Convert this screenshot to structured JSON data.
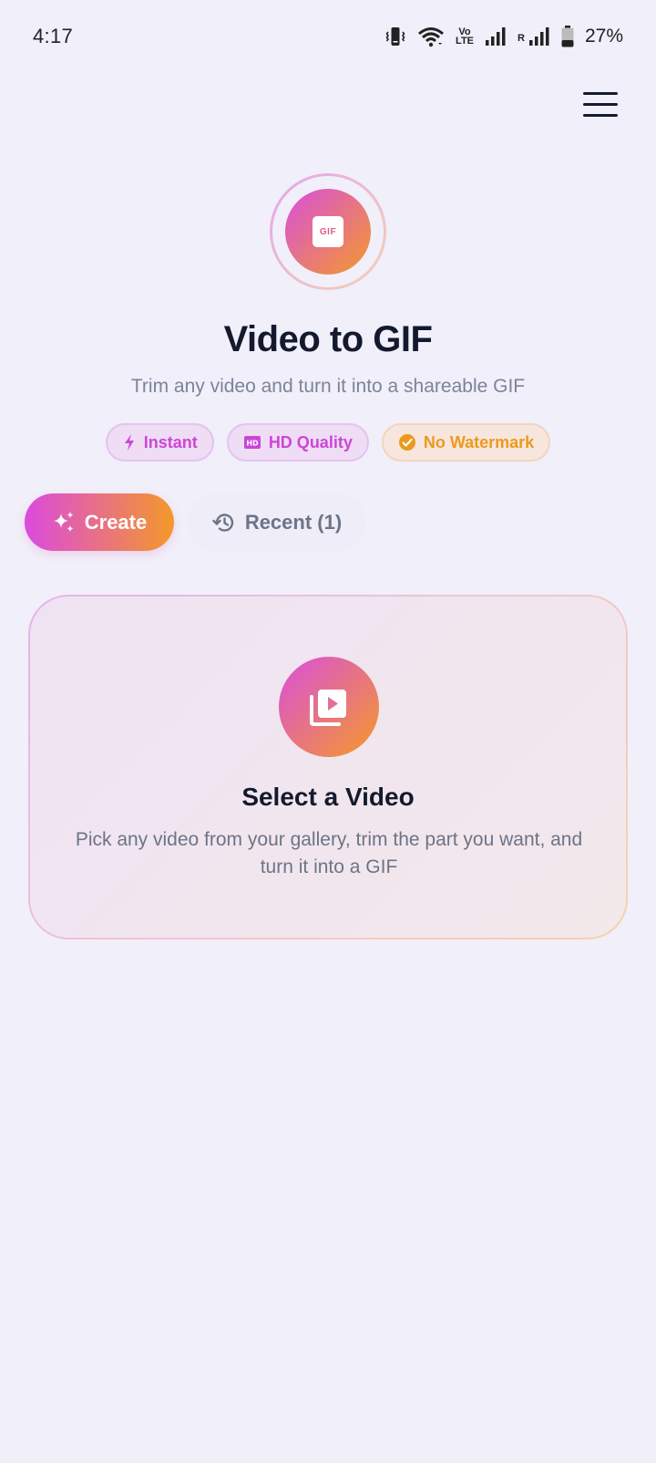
{
  "status_bar": {
    "time": "4:17",
    "volte_line1": "Vo",
    "volte_line2": "LTE",
    "roaming": "R",
    "battery": "27%"
  },
  "header": {
    "logo_badge": "GIF",
    "title": "Video to GIF",
    "subtitle": "Trim any video and turn it into a shareable GIF"
  },
  "features": [
    {
      "label": "Instant",
      "icon": "bolt-icon",
      "color": "#cc46d6"
    },
    {
      "label": "HD Quality",
      "icon": "hd-icon",
      "color": "#cc46d6"
    },
    {
      "label": "No Watermark",
      "icon": "check-circle-icon",
      "color": "#ec9a1c"
    }
  ],
  "tabs": {
    "create": "Create",
    "recent": "Recent (1)"
  },
  "card": {
    "title": "Select a Video",
    "description": "Pick any video from your gallery, trim the part you want, and turn it into a GIF"
  },
  "colors": {
    "accent_pink": "#d94fdc",
    "accent_orange": "#f39a2a",
    "background": "#f1eff9"
  }
}
